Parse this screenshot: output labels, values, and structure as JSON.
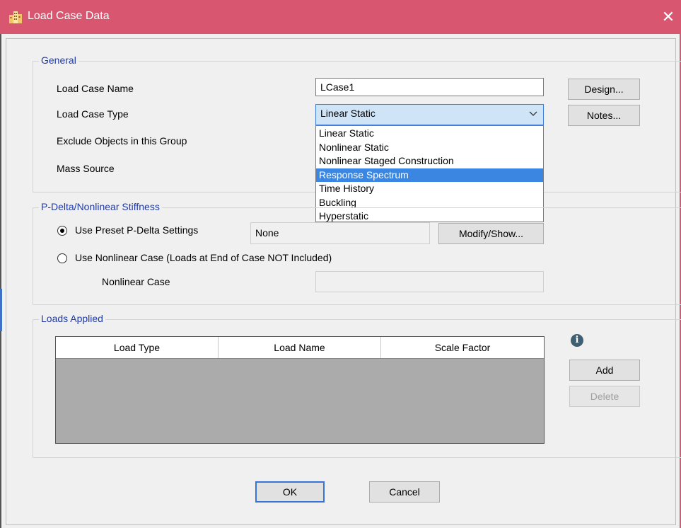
{
  "window": {
    "title": "Load Case Data",
    "close_glyph": "✕"
  },
  "general": {
    "legend": "General",
    "load_case_name_label": "Load Case Name",
    "load_case_name_value": "LCase1",
    "load_case_type_label": "Load Case Type",
    "load_case_type_value": "Linear Static",
    "exclude_label": "Exclude Objects in this Group",
    "mass_source_label": "Mass Source",
    "design_button": "Design...",
    "notes_button": "Notes...",
    "type_options": [
      "Linear Static",
      "Nonlinear Static",
      "Nonlinear Staged Construction",
      "Response Spectrum",
      "Time History",
      "Buckling",
      "Hyperstatic"
    ],
    "highlighted_option": "Response Spectrum"
  },
  "pdelta": {
    "legend": "P-Delta/Nonlinear Stiffness",
    "preset_label": "Use Preset P-Delta Settings",
    "preset_value": "None",
    "modify_button": "Modify/Show...",
    "nonlinear_label": "Use Nonlinear Case  (Loads at End of Case NOT Included)",
    "nonlinear_case_label": "Nonlinear Case",
    "nonlinear_case_value": ""
  },
  "loads": {
    "legend": "Loads Applied",
    "columns": [
      "Load Type",
      "Load Name",
      "Scale Factor"
    ],
    "add_button": "Add",
    "delete_button": "Delete",
    "info_glyph": "i"
  },
  "footer": {
    "ok_button": "OK",
    "cancel_button": "Cancel"
  },
  "colors": {
    "titlebar": "#d8566f",
    "highlight": "#3b86e0",
    "legend_text": "#1f3aa8"
  },
  "icons": {
    "app": "building-icon",
    "info": "info-icon",
    "dropdown": "chevron-down-icon"
  }
}
